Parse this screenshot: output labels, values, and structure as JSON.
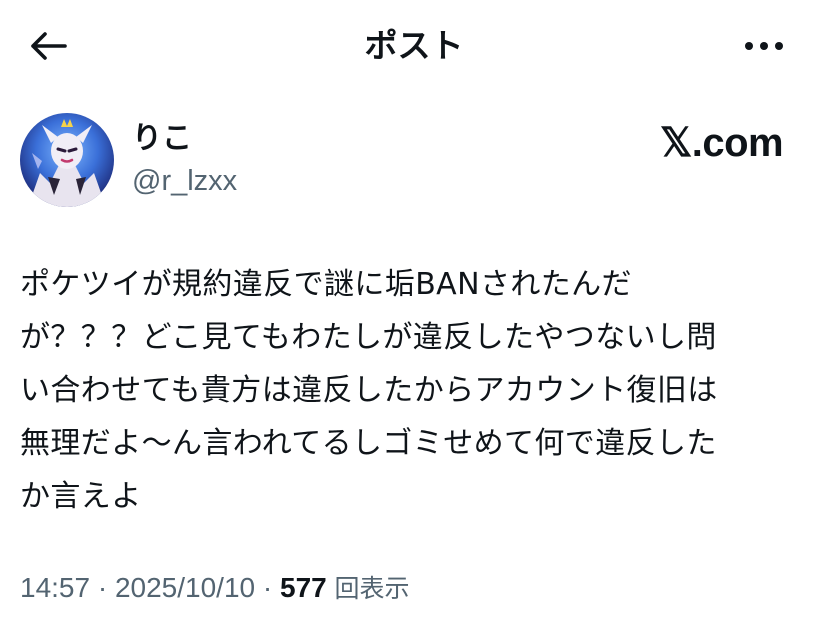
{
  "header": {
    "title": "ポスト",
    "back_icon": "arrow-left-icon",
    "more_icon": "more-horizontal-icon"
  },
  "author": {
    "display_name": "りこ",
    "handle": "@r_lzxx",
    "avatar_icon": "user-avatar"
  },
  "watermark": "𝕏.com",
  "post": {
    "lines": [
      "ポケツイが規約違反で謎に垢BANされたんだ",
      "が？？？どこ見てもわたしが違反したやつないし問",
      "い合わせても貴方は違反したからアカウント復旧は",
      "無理だよ〜ん言われてるしゴミせめて何で違反した",
      "か言えよ"
    ]
  },
  "meta": {
    "time": "14:57",
    "separator": " · ",
    "date": "2025/10/10",
    "views_count": "577",
    "views_label": "回表示"
  },
  "colors": {
    "text": "#0f1419",
    "secondary": "#536471",
    "background": "#ffffff"
  }
}
